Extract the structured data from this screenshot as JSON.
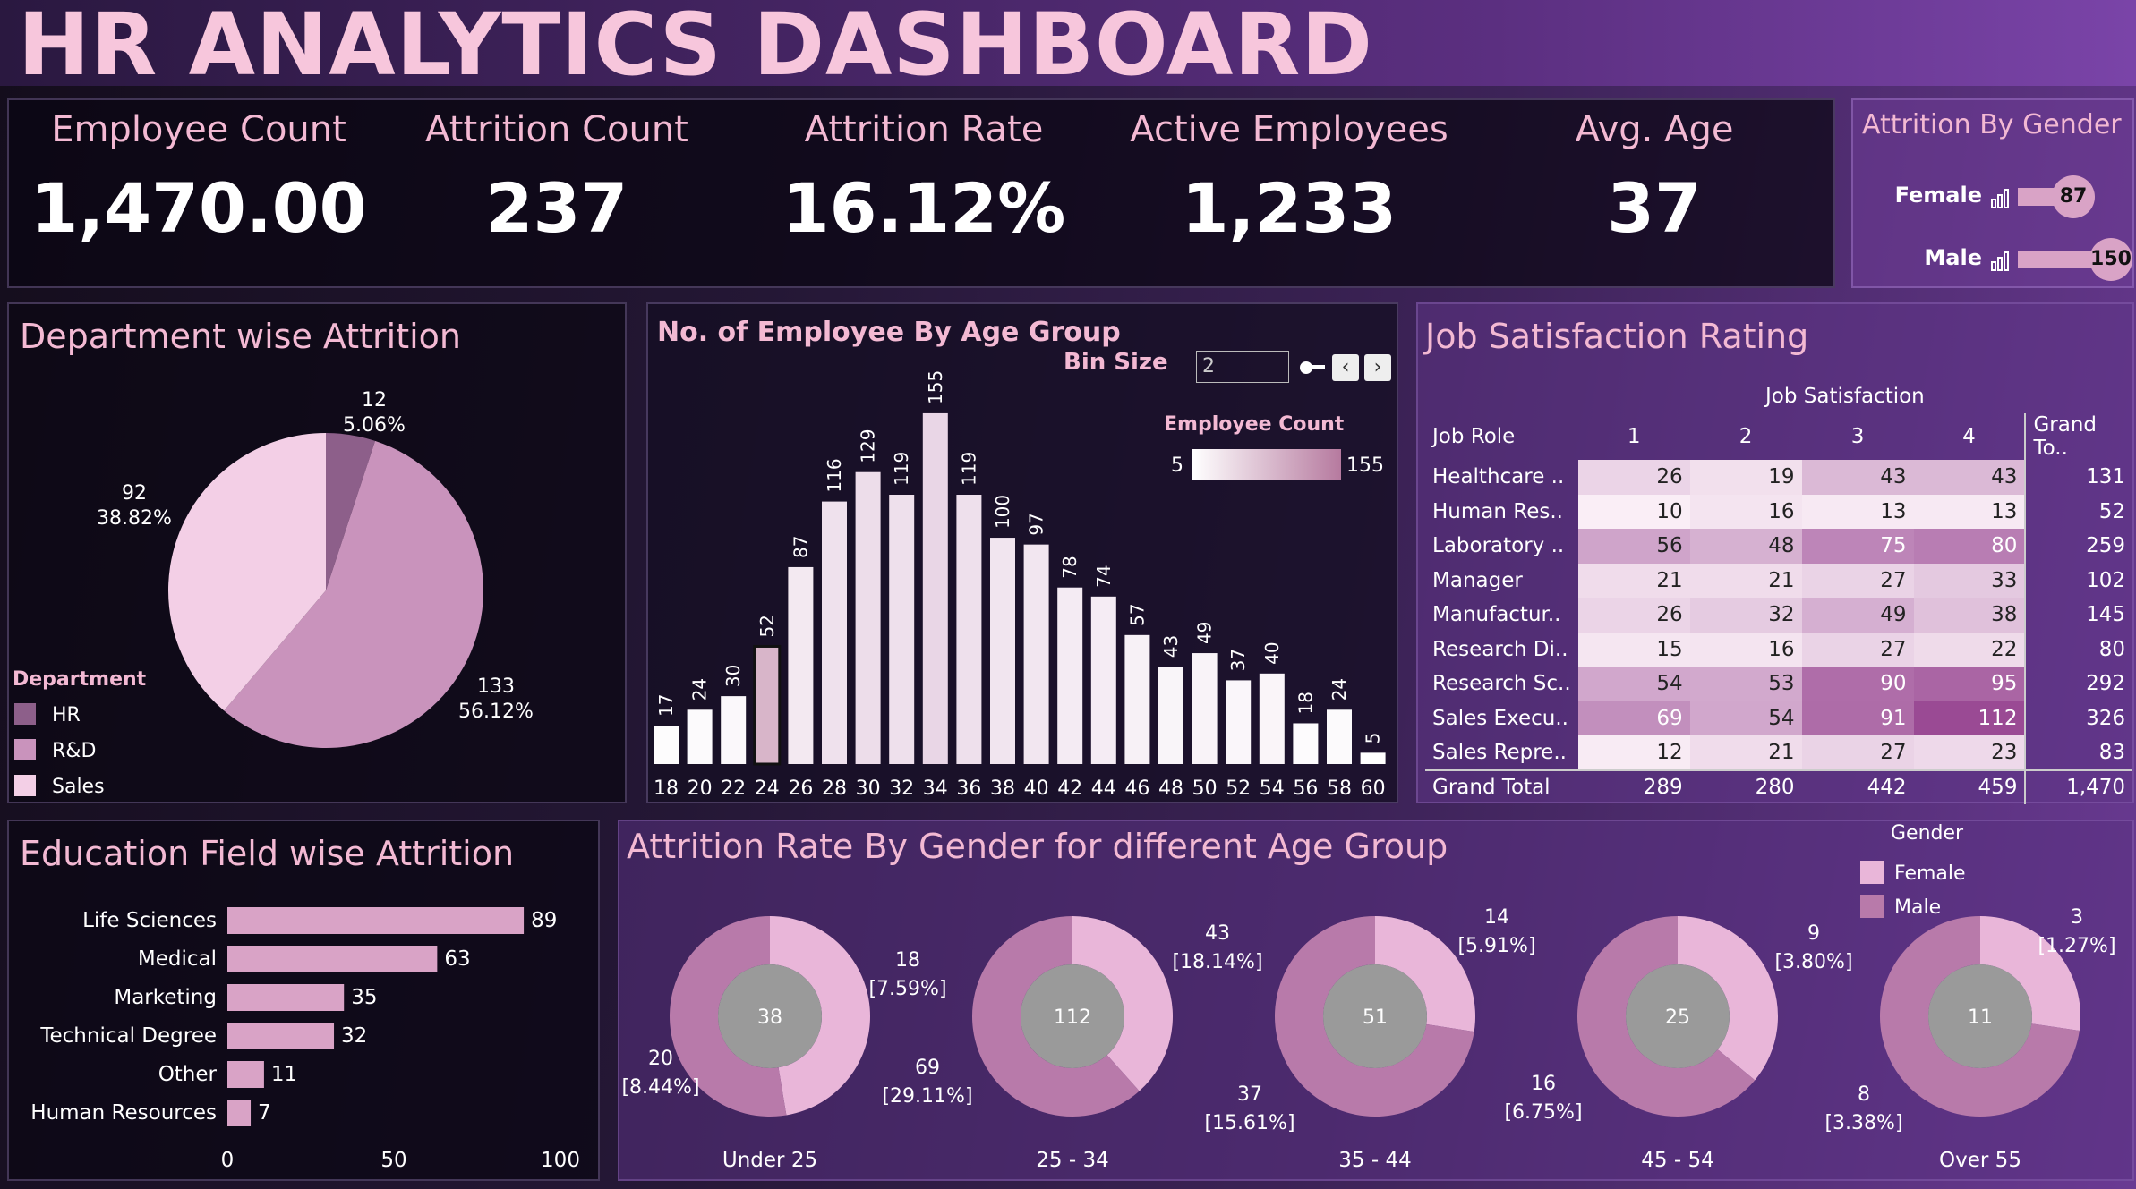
{
  "dashboard_title": "HR ANALYTICS DASHBOARD",
  "kpis": [
    {
      "label": "Employee Count",
      "value": "1,470.00"
    },
    {
      "label": "Attrition Count",
      "value": "237"
    },
    {
      "label": "Attrition Rate",
      "value": "16.12%"
    },
    {
      "label": "Active Employees",
      "value": "1,233"
    },
    {
      "label": "Avg. Age",
      "value": "37"
    }
  ],
  "colors": {
    "light_pink": "#f3cfe6",
    "mid_pink": "#c993bc",
    "dark_mauve": "#8d5f8a",
    "title_pink": "#f3b9d3",
    "grey": "#9a9a9a"
  },
  "chart_data": [
    {
      "id": "attrition_by_gender",
      "type": "bar",
      "title": "Attrition By Gender",
      "categories": [
        "Female",
        "Male"
      ],
      "values": [
        87,
        150
      ],
      "value_labels": [
        "87",
        "150"
      ]
    },
    {
      "id": "department_attrition",
      "type": "pie",
      "title": "Department wise Attrition",
      "legend_title": "Department",
      "legend_placement": "bottom-left",
      "categories": [
        "HR",
        "R&D",
        "Sales"
      ],
      "values": [
        12,
        133,
        92
      ],
      "percent_labels": [
        "5.06%",
        "56.12%",
        "38.82%"
      ],
      "value_labels": [
        "12",
        "133",
        "92"
      ],
      "colors": [
        "#8d5f8a",
        "#c993bc",
        "#f3cfe6"
      ]
    },
    {
      "id": "employees_by_age_group",
      "type": "bar",
      "title": "No. of Employee By Age Group",
      "bin_size_label": "Bin Size",
      "bin_size_value": "2",
      "color_legend_title": "Employee Count",
      "color_range": [
        5,
        155
      ],
      "color_range_labels": [
        "5",
        "155"
      ],
      "categories": [
        "18",
        "20",
        "22",
        "24",
        "26",
        "28",
        "30",
        "32",
        "34",
        "36",
        "38",
        "40",
        "42",
        "44",
        "46",
        "48",
        "50",
        "52",
        "54",
        "56",
        "58",
        "60"
      ],
      "values": [
        17,
        24,
        30,
        52,
        87,
        116,
        129,
        119,
        155,
        119,
        100,
        97,
        78,
        74,
        57,
        43,
        49,
        37,
        40,
        18,
        24,
        5
      ],
      "highlighted": "24",
      "ylim": [
        0,
        170
      ]
    },
    {
      "id": "job_satisfaction",
      "type": "table",
      "title": "Job Satisfaction Rating",
      "column_group_label": "Job Satisfaction",
      "row_header": "Job Role",
      "columns": [
        "1",
        "2",
        "3",
        "4"
      ],
      "grand_total_col_label": "Grand To..",
      "rows": [
        {
          "role": "Healthcare ..",
          "values": [
            "26",
            "19",
            "43",
            "43"
          ],
          "total": "131"
        },
        {
          "role": "Human Res..",
          "values": [
            "10",
            "16",
            "13",
            "13"
          ],
          "total": "52"
        },
        {
          "role": "Laboratory ..",
          "values": [
            "56",
            "48",
            "75",
            "80"
          ],
          "total": "259"
        },
        {
          "role": "Manager",
          "values": [
            "21",
            "21",
            "27",
            "33"
          ],
          "total": "102"
        },
        {
          "role": "Manufactur..",
          "values": [
            "26",
            "32",
            "49",
            "38"
          ],
          "total": "145"
        },
        {
          "role": "Research Di..",
          "values": [
            "15",
            "16",
            "27",
            "22"
          ],
          "total": "80"
        },
        {
          "role": "Research Sc..",
          "values": [
            "54",
            "53",
            "90",
            "95"
          ],
          "total": "292"
        },
        {
          "role": "Sales Execu..",
          "values": [
            "69",
            "54",
            "91",
            "112"
          ],
          "total": "326"
        },
        {
          "role": "Sales Repre..",
          "values": [
            "12",
            "21",
            "27",
            "23"
          ],
          "total": "83"
        }
      ],
      "grand_total_row": {
        "label": "Grand Total",
        "values": [
          "289",
          "280",
          "442",
          "459"
        ],
        "total": "1,470"
      }
    },
    {
      "id": "education_field_attrition",
      "type": "bar",
      "orientation": "horizontal",
      "title": "Education Field wise Attrition",
      "categories": [
        "Life Sciences",
        "Medical",
        "Marketing",
        "Technical Degree",
        "Other",
        "Human Resources"
      ],
      "values": [
        89,
        63,
        35,
        32,
        11,
        7
      ],
      "xlim": [
        0,
        100
      ],
      "ticks": [
        "0",
        "50",
        "100"
      ]
    },
    {
      "id": "attrition_rate_by_gender_age",
      "type": "pie",
      "subtype": "donut",
      "title": "Attrition Rate By Gender for different Age Group",
      "legend_title": "Gender",
      "legend_placement": "top-right",
      "series_names": [
        "Female",
        "Male"
      ],
      "groups": [
        {
          "age": "Under 25",
          "total": "38",
          "female": 18,
          "female_label": "18",
          "female_pct": "[7.59%]",
          "male": 20,
          "male_label": "20",
          "male_pct": "[8.44%]"
        },
        {
          "age": "25 - 34",
          "total": "112",
          "female": 43,
          "female_label": "43",
          "female_pct": "[18.14%]",
          "male": 69,
          "male_label": "69",
          "male_pct": "[29.11%]"
        },
        {
          "age": "35 - 44",
          "total": "51",
          "female": 14,
          "female_label": "14",
          "female_pct": "[5.91%]",
          "male": 37,
          "male_label": "37",
          "male_pct": "[15.61%]"
        },
        {
          "age": "45 - 54",
          "total": "25",
          "female": 9,
          "female_label": "9",
          "female_pct": "[3.80%]",
          "male": 16,
          "male_label": "16",
          "male_pct": "[6.75%]"
        },
        {
          "age": "Over 55",
          "total": "11",
          "female": 3,
          "female_label": "3",
          "female_pct": "[1.27%]",
          "male": 8,
          "male_label": "8",
          "male_pct": "[3.38%]"
        }
      ]
    }
  ]
}
